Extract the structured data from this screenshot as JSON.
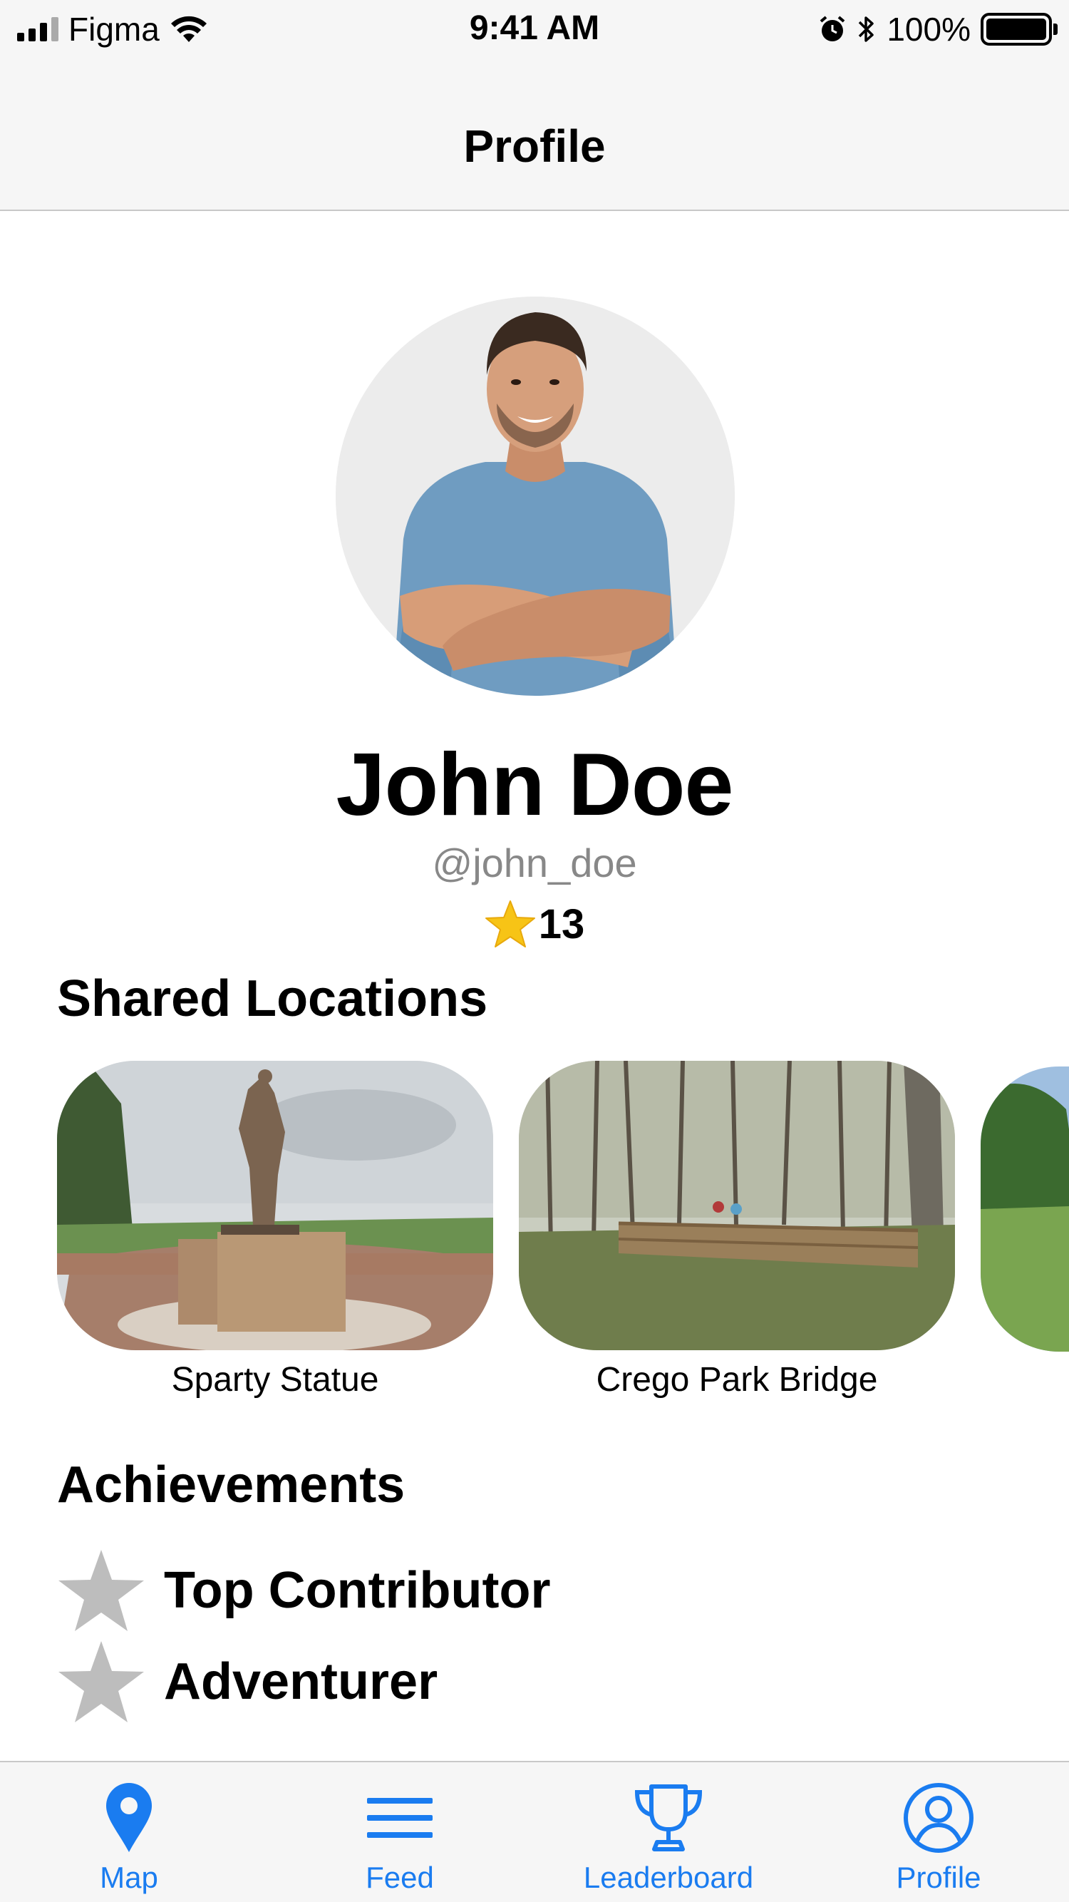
{
  "status_bar": {
    "carrier": "Figma",
    "time": "9:41 AM",
    "battery": "100%",
    "icons": [
      "signal-icon",
      "wifi-icon",
      "alarm-icon",
      "bluetooth-icon",
      "battery-icon"
    ]
  },
  "header": {
    "title": "Profile"
  },
  "profile": {
    "name": "John Doe",
    "handle": "@john_doe",
    "score": "13",
    "score_icon": "star-icon"
  },
  "shared_locations": {
    "title": "Shared Locations",
    "items": [
      {
        "label": "Sparty Statue"
      },
      {
        "label": "Crego Park Bridge"
      }
    ]
  },
  "achievements": {
    "title": "Achievements",
    "items": [
      {
        "label": "Top Contributor",
        "icon": "star-icon"
      },
      {
        "label": "Adventurer",
        "icon": "star-icon"
      }
    ]
  },
  "tab_bar": {
    "accent": "#1a7cf0",
    "tabs": [
      {
        "label": "Map",
        "icon": "map-pin-icon"
      },
      {
        "label": "Feed",
        "icon": "feed-lines-icon"
      },
      {
        "label": "Leaderboard",
        "icon": "trophy-icon"
      },
      {
        "label": "Profile",
        "icon": "profile-icon"
      }
    ]
  }
}
